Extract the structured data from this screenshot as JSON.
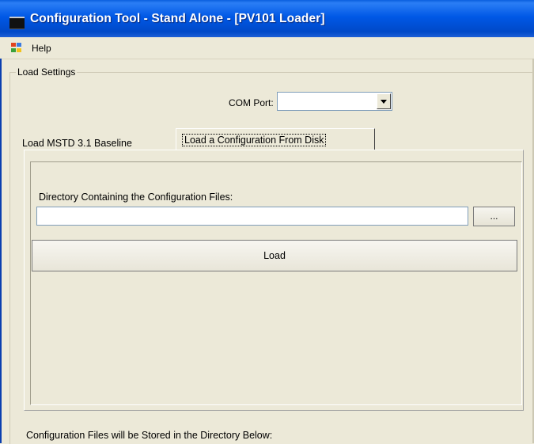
{
  "window": {
    "title": "Configuration Tool - Stand Alone - [PV101 Loader]"
  },
  "menu": {
    "help": "Help"
  },
  "load_settings": {
    "group_label": "Load Settings",
    "com_port_label": "COM Port:",
    "com_port_value": ""
  },
  "tabs": [
    {
      "label": "Load MSTD 3.1 Baseline",
      "selected": false
    },
    {
      "label": "Load a Configuration From Disk",
      "selected": true
    }
  ],
  "disk_tab": {
    "directory_label": "Directory Containing the Configuration Files:",
    "directory_value": "",
    "browse_label": "...",
    "load_label": "Load"
  },
  "footer": {
    "text": "Configuration Files will be Stored in the Directory Below:"
  }
}
